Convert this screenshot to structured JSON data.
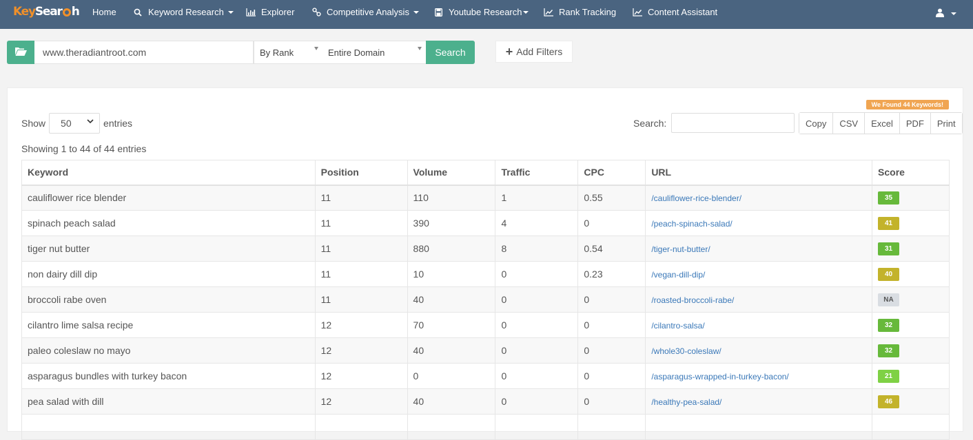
{
  "brand": {
    "key": "Key",
    "search_a": "Sear",
    "search_b": "h"
  },
  "nav": {
    "items": [
      {
        "label": "Home",
        "icon": "none",
        "dropdown": false
      },
      {
        "label": "Keyword Research",
        "icon": "search-icon",
        "dropdown": true
      },
      {
        "label": "Explorer",
        "icon": "bar-chart-icon",
        "dropdown": false
      },
      {
        "label": "Competitive Analysis",
        "icon": "link-icon",
        "dropdown": true
      },
      {
        "label": "Youtube Research",
        "icon": "save-icon",
        "dropdown": true
      },
      {
        "label": "Rank Tracking",
        "icon": "line-chart-icon",
        "dropdown": false
      },
      {
        "label": "Content Assistant",
        "icon": "line-chart-icon",
        "dropdown": false
      }
    ],
    "user_icon": "user-icon"
  },
  "search": {
    "domain_value": "www.theradiantroot.com",
    "mode_selected": "By Rank",
    "scope_selected": "Entire Domain",
    "search_label": "Search",
    "add_filters_label": "Add Filters"
  },
  "results": {
    "found_badge": "We Found 44 Keywords!",
    "show_label": "Show",
    "entries_value": "50",
    "entries_label": "entries",
    "table_search_label": "Search:",
    "table_search_value": "",
    "export_buttons": [
      "Copy",
      "CSV",
      "Excel",
      "PDF",
      "Print"
    ],
    "info": "Showing 1 to 44 of 44 entries",
    "columns": [
      "Keyword",
      "Position",
      "Volume",
      "Traffic",
      "CPC",
      "URL",
      "Score"
    ],
    "rows": [
      {
        "keyword": "cauliflower rice blender",
        "position": "11",
        "volume": "110",
        "traffic": "1",
        "cpc": "0.55",
        "url": "/cauliflower-rice-blender/",
        "score": "35",
        "score_color": "#67b93b"
      },
      {
        "keyword": "spinach peach salad",
        "position": "11",
        "volume": "390",
        "traffic": "4",
        "cpc": "0",
        "url": "/peach-spinach-salad/",
        "score": "41",
        "score_color": "#c3b32b"
      },
      {
        "keyword": "tiger nut butter",
        "position": "11",
        "volume": "880",
        "traffic": "8",
        "cpc": "0.54",
        "url": "/tiger-nut-butter/",
        "score": "31",
        "score_color": "#67b93b"
      },
      {
        "keyword": "non dairy dill dip",
        "position": "11",
        "volume": "10",
        "traffic": "0",
        "cpc": "0.23",
        "url": "/vegan-dill-dip/",
        "score": "40",
        "score_color": "#c3b32b"
      },
      {
        "keyword": "broccoli rabe oven",
        "position": "11",
        "volume": "40",
        "traffic": "0",
        "cpc": "0",
        "url": "/roasted-broccoli-rabe/",
        "score": "NA",
        "score_color": "#d9dde2"
      },
      {
        "keyword": "cilantro lime salsa recipe",
        "position": "12",
        "volume": "70",
        "traffic": "0",
        "cpc": "0",
        "url": "/cilantro-salsa/",
        "score": "32",
        "score_color": "#67b93b"
      },
      {
        "keyword": "paleo coleslaw no mayo",
        "position": "12",
        "volume": "40",
        "traffic": "0",
        "cpc": "0",
        "url": "/whole30-coleslaw/",
        "score": "32",
        "score_color": "#67b93b"
      },
      {
        "keyword": "asparagus bundles with turkey bacon",
        "position": "12",
        "volume": "0",
        "traffic": "0",
        "cpc": "0",
        "url": "/asparagus-wrapped-in-turkey-bacon/",
        "score": "21",
        "score_color": "#7fd145"
      },
      {
        "keyword": "pea salad with dill",
        "position": "12",
        "volume": "40",
        "traffic": "0",
        "cpc": "0",
        "url": "/healthy-pea-salad/",
        "score": "46",
        "score_color": "#c3b32b"
      },
      {
        "keyword": "",
        "position": "",
        "volume": "",
        "traffic": "",
        "cpc": "",
        "url": "",
        "score": "",
        "score_color": ""
      }
    ]
  }
}
